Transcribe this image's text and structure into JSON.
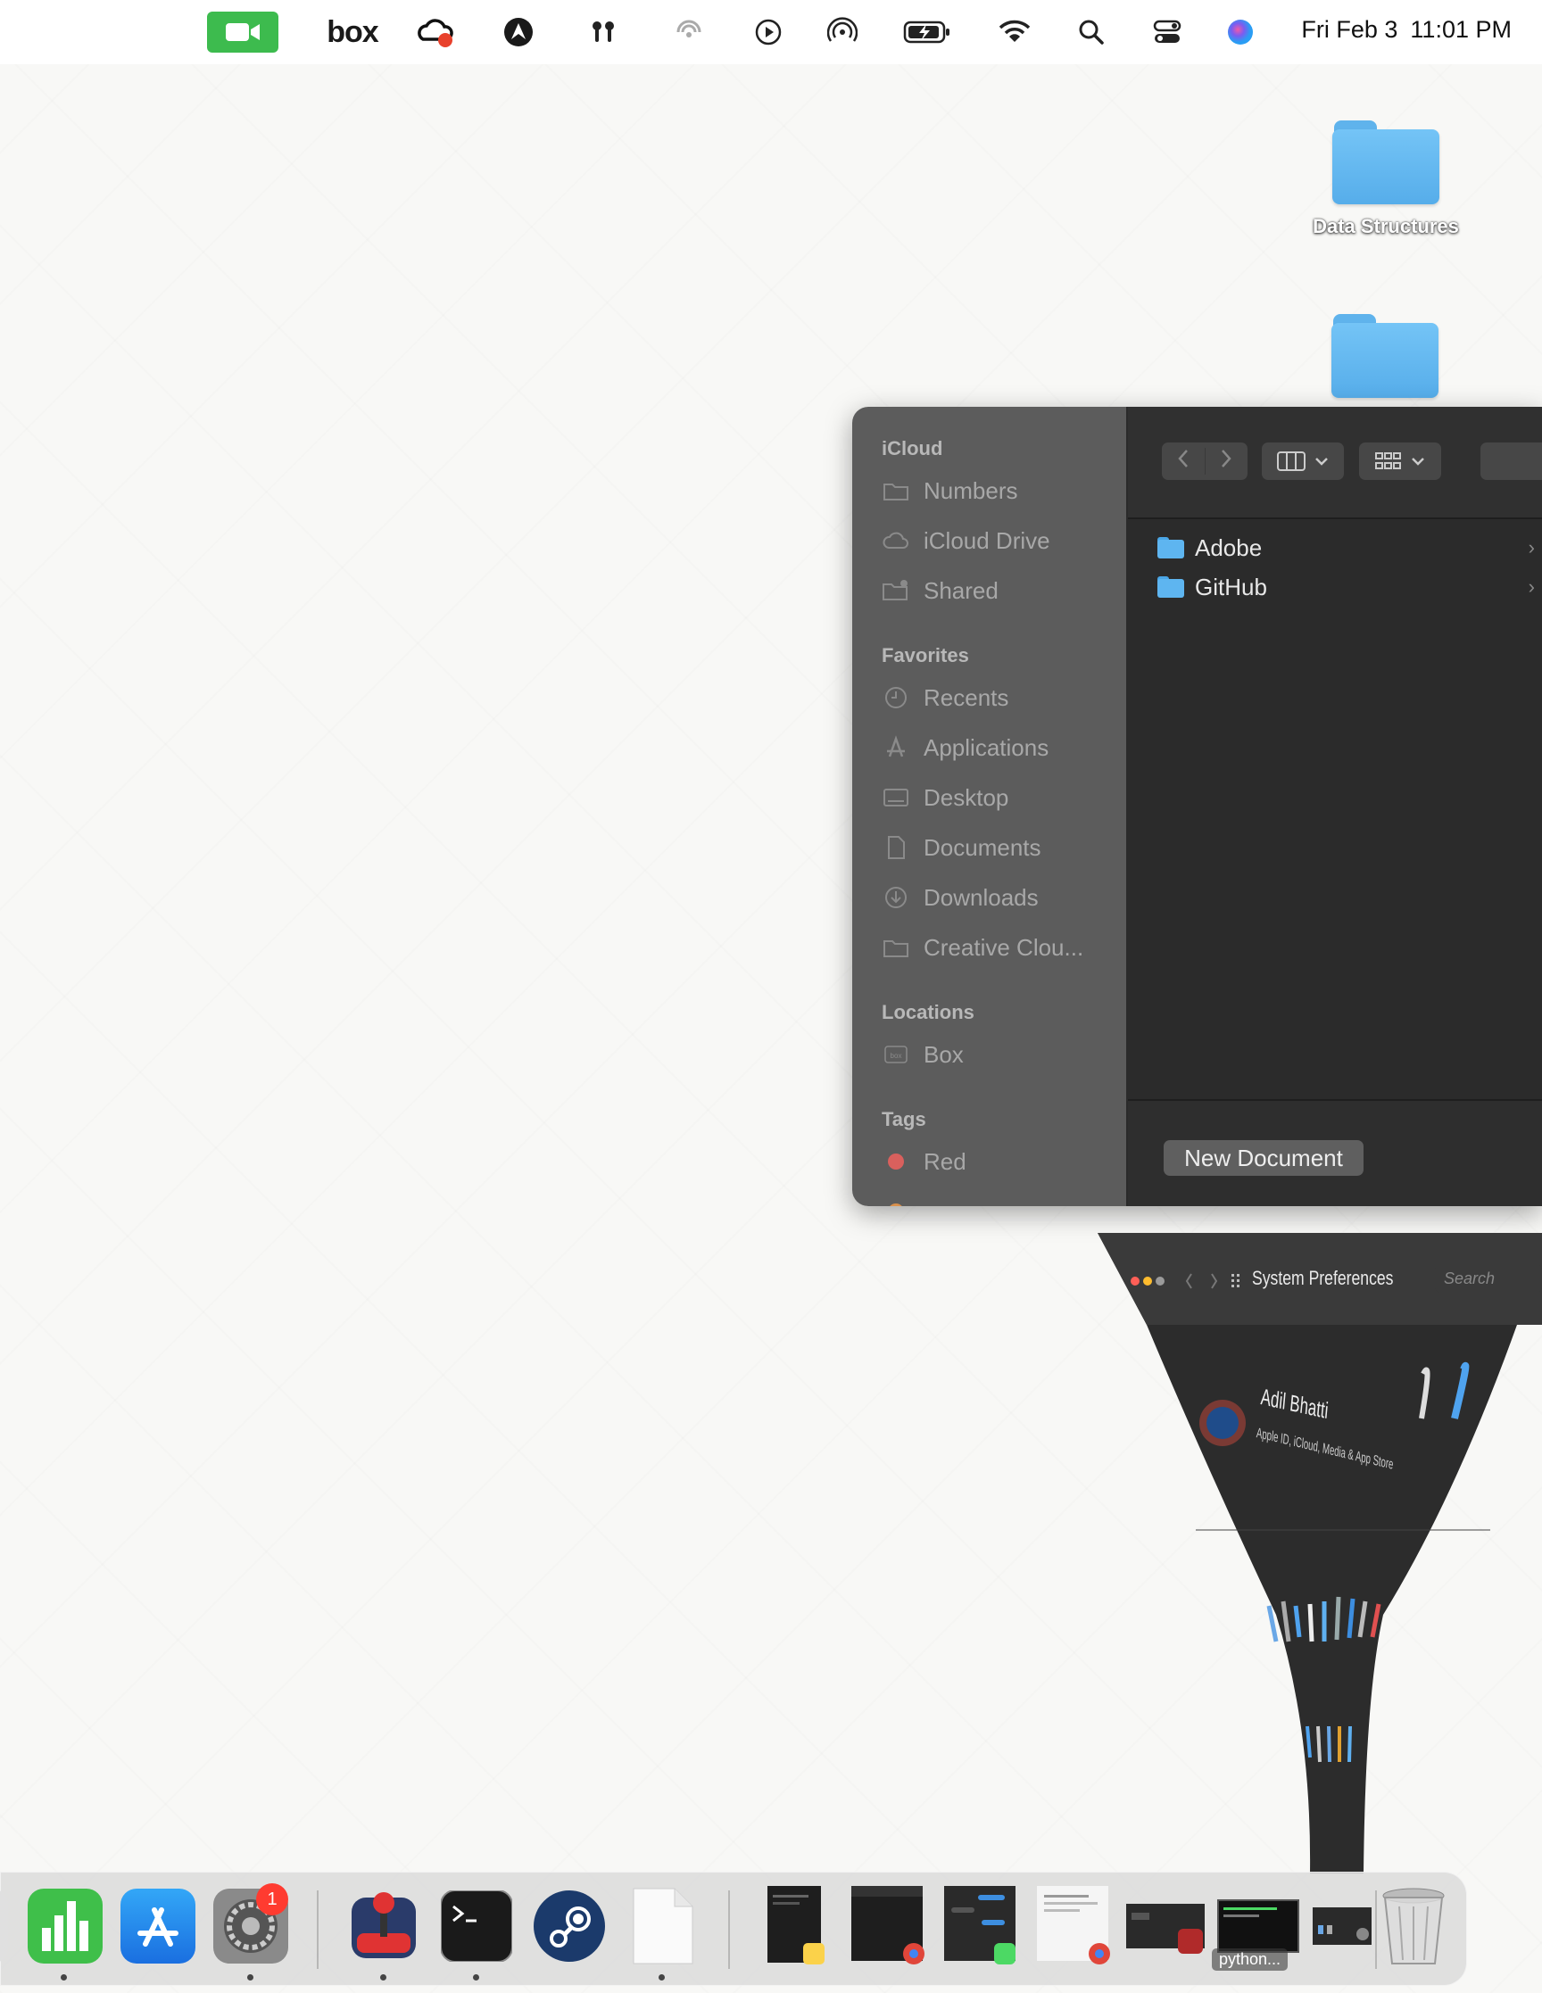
{
  "menubar": {
    "box_label": "box",
    "clock_day": "Fri Feb 3",
    "clock_time": "11:01 PM",
    "icons": [
      "facetime-icon",
      "box-icon",
      "creative-cloud-icon",
      "avast-icon",
      "airpods-icon",
      "focus-icon",
      "media-play-icon",
      "airdrop-icon",
      "battery-icon",
      "wifi-icon",
      "spotlight-search-icon",
      "control-center-icon",
      "siri-icon"
    ]
  },
  "desktop": {
    "icons": [
      {
        "label": "Data Structures"
      },
      {
        "label": ""
      }
    ]
  },
  "dialog": {
    "sidebar": {
      "icloud_header": "iCloud",
      "icloud_items": [
        "Numbers",
        "iCloud Drive",
        "Shared"
      ],
      "favorites_header": "Favorites",
      "favorites_items": [
        "Recents",
        "Applications",
        "Desktop",
        "Documents",
        "Downloads",
        "Creative Clou..."
      ],
      "locations_header": "Locations",
      "locations_items": [
        "Box"
      ],
      "tags_header": "Tags",
      "tags_items": [
        "Red"
      ]
    },
    "files": [
      "Adobe",
      "GitHub"
    ],
    "new_document_label": "New Document"
  },
  "genie_window": {
    "title": "System Preferences",
    "search_placeholder": "Search",
    "user_name": "Adil Bhatti",
    "user_sub": "Apple ID, iCloud, Media & App Store"
  },
  "dock": {
    "settings_badge": "1",
    "hover_label": "python..."
  }
}
